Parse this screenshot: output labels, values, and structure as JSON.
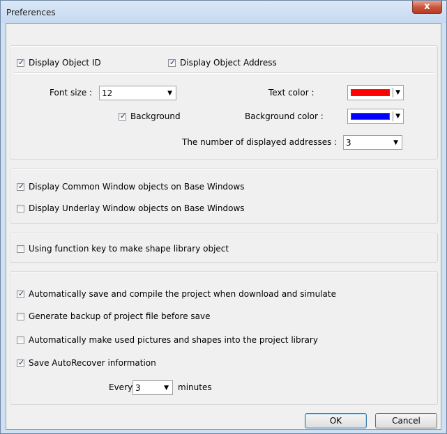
{
  "window": {
    "title": "Preferences",
    "close_glyph": "x"
  },
  "display_group": {
    "display_object_id": {
      "label": "Display Object ID",
      "checked": true
    },
    "display_object_address": {
      "label": "Display Object Address",
      "checked": true
    },
    "font_size": {
      "label": "Font size :",
      "value": "12"
    },
    "text_color": {
      "label": "Text color :",
      "color": "#ff0000"
    },
    "background": {
      "label": "Background",
      "checked": true
    },
    "background_color": {
      "label": "Background color :",
      "color": "#0000ff"
    },
    "num_addresses": {
      "label": "The number of displayed addresses :",
      "value": "3"
    }
  },
  "window_group": {
    "common_window": {
      "label": "Display Common Window objects on Base Windows",
      "checked": true
    },
    "underlay_window": {
      "label": "Display Underlay Window objects on Base Windows",
      "checked": false
    }
  },
  "shape_group": {
    "function_key": {
      "label": "Using function key to make shape library object",
      "checked": false
    }
  },
  "project_group": {
    "auto_save_compile": {
      "label": "Automatically save and compile the project when download and simulate",
      "checked": true
    },
    "generate_backup": {
      "label": "Generate backup of project file before save",
      "checked": false
    },
    "auto_library": {
      "label": "Automatically make used pictures and shapes into the project library",
      "checked": false
    },
    "autorecover": {
      "label": "Save AutoRecover information",
      "checked": true
    },
    "every_label": "Every",
    "every_value": "3",
    "minutes_label": "minutes"
  },
  "buttons": {
    "ok": "OK",
    "cancel": "Cancel"
  },
  "glyphs": {
    "check": "✓",
    "dropdown": "▼"
  }
}
